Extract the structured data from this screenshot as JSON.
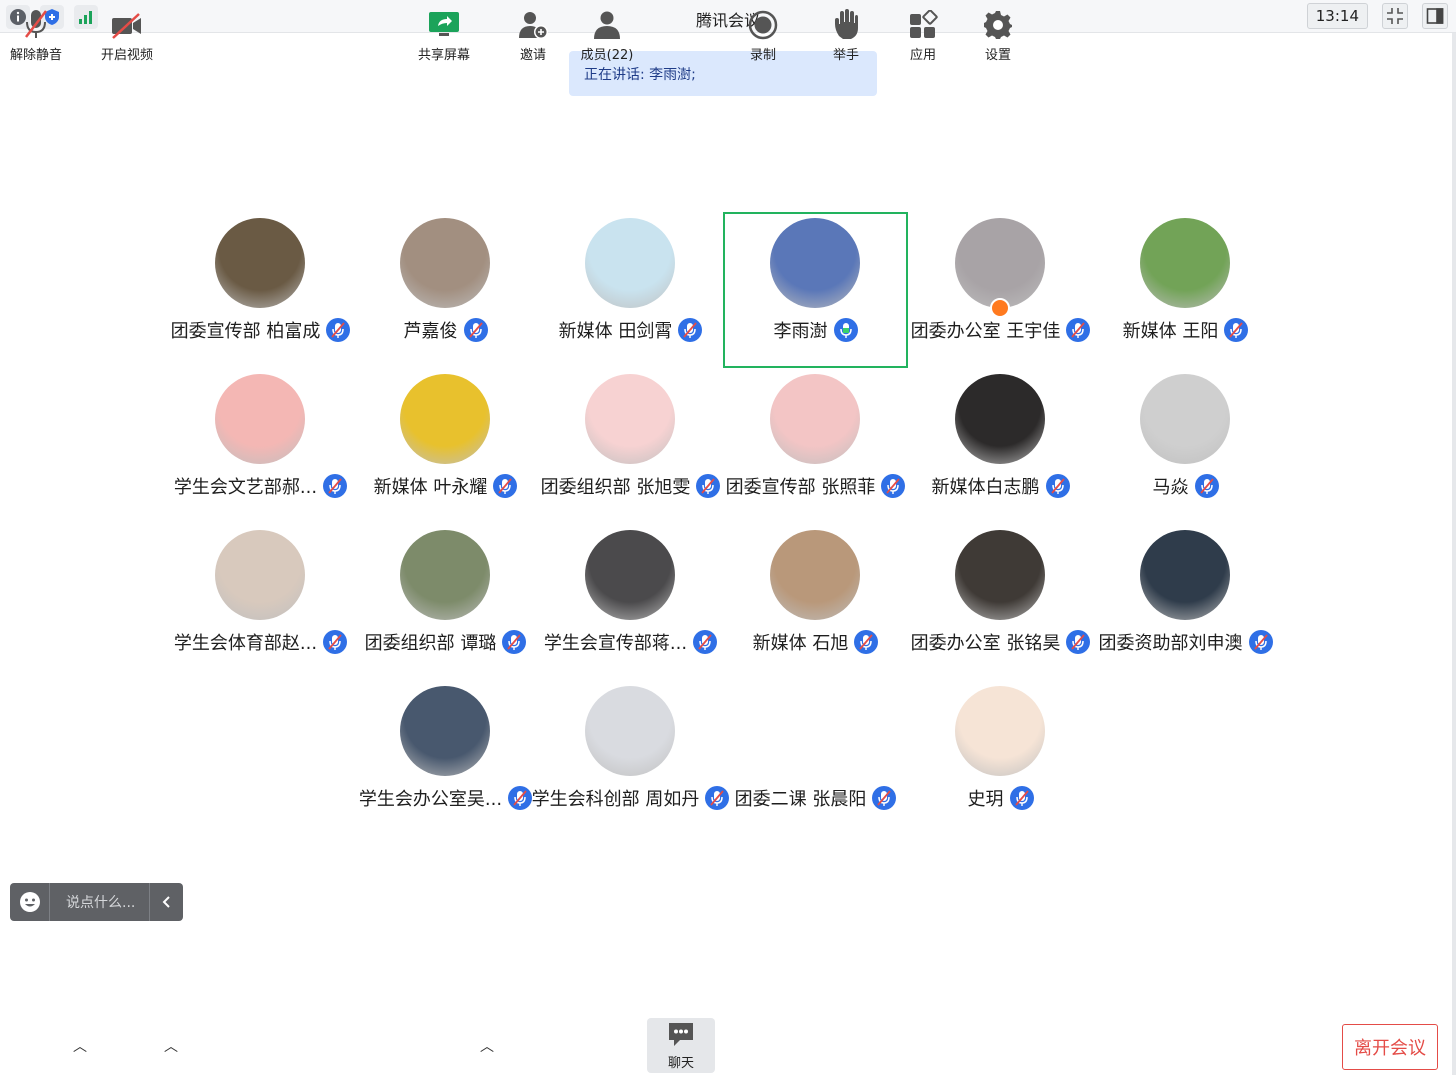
{
  "window": {
    "title": "腾讯会议",
    "time": "13:14"
  },
  "titlebar_icons": [
    "info-icon",
    "shield-icon",
    "signal-icon"
  ],
  "speaking_banner": "正在讲话: 李雨澍;",
  "participants": [
    {
      "name": "团委宣传部 柏富成",
      "avatar_color": "#6a5a44",
      "mic": "muted"
    },
    {
      "name": "芦嘉俊",
      "avatar_color": "#a28f80",
      "mic": "muted"
    },
    {
      "name": "新媒体 田剑霄",
      "avatar_color": "#c9e3ef",
      "mic": "muted"
    },
    {
      "name": "李雨澍",
      "avatar_color": "#5a77b8",
      "mic": "speaking",
      "active": true
    },
    {
      "name": "团委办公室 王宇佳",
      "avatar_color": "#a8a3a6",
      "mic": "muted",
      "badge": true
    },
    {
      "name": "新媒体 王阳",
      "avatar_color": "#72a357",
      "mic": "muted"
    },
    {
      "name": "学生会文艺部郝...",
      "avatar_color": "#f4b7b4",
      "mic": "muted"
    },
    {
      "name": "新媒体 叶永耀",
      "avatar_color": "#e8c12d",
      "mic": "muted"
    },
    {
      "name": "团委组织部 张旭雯",
      "avatar_color": "#f7d2d2",
      "mic": "muted"
    },
    {
      "name": "团委宣传部 张照菲",
      "avatar_color": "#f3c5c5",
      "mic": "muted"
    },
    {
      "name": "新媒体白志鹏",
      "avatar_color": "#2c2a2a",
      "mic": "muted"
    },
    {
      "name": "马焱",
      "avatar_color": "#cfcfcf",
      "mic": "muted"
    },
    {
      "name": "学生会体育部赵...",
      "avatar_color": "#d8c9bd",
      "mic": "muted"
    },
    {
      "name": "团委组织部 谭璐",
      "avatar_color": "#7d8b6a",
      "mic": "muted"
    },
    {
      "name": "学生会宣传部蒋...",
      "avatar_color": "#4b4a4c",
      "mic": "muted"
    },
    {
      "name": "新媒体 石旭",
      "avatar_color": "#b9987a",
      "mic": "muted"
    },
    {
      "name": "团委办公室 张铭昊",
      "avatar_color": "#3f3a36",
      "mic": "muted"
    },
    {
      "name": "团委资助部刘申澳",
      "avatar_color": "#2f3c4b",
      "mic": "muted"
    },
    {
      "name": "学生会办公室吴...",
      "avatar_color": "#48586e",
      "mic": "muted"
    },
    {
      "name": "学生会科创部 周如丹",
      "avatar_color": "#d9dbe0",
      "mic": "muted"
    },
    {
      "name": "团委二课 张晨阳",
      "avatar_color": "#ffffff",
      "mic": "muted"
    },
    {
      "name": "史玥",
      "avatar_color": "#f6e4d6",
      "mic": "muted"
    }
  ],
  "chat_input": {
    "placeholder": "说点什么..."
  },
  "toolbar": {
    "unmute": "解除静音",
    "video": "开启视频",
    "share": "共享屏幕",
    "invite": "邀请",
    "members": "成员(22)",
    "chat": "聊天",
    "record": "录制",
    "raise_hand": "举手",
    "apps": "应用",
    "settings": "设置",
    "leave": "离开会议"
  },
  "colors": {
    "accent": "#2f6fe6",
    "active_border": "#22b35e",
    "leave": "#e44c47",
    "share_green": "#1ba35a"
  }
}
